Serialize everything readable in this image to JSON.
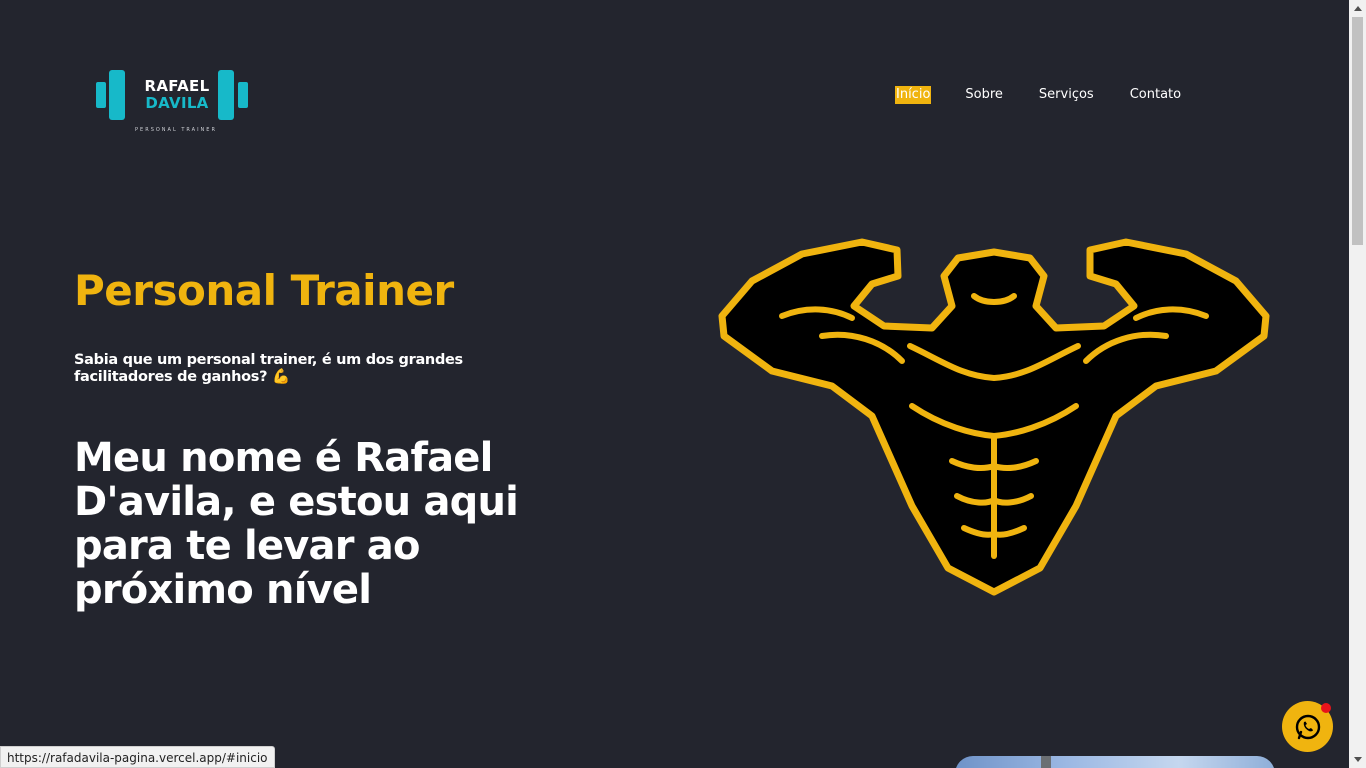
{
  "logo": {
    "line1": "RAFAEL",
    "line2": "DAVILA",
    "subtitle": "PERSONAL TRAINER",
    "accent_color": "#17b9c9"
  },
  "nav": {
    "items": [
      {
        "label": "Início",
        "active": true
      },
      {
        "label": "Sobre",
        "active": false
      },
      {
        "label": "Serviços",
        "active": false
      },
      {
        "label": "Contato",
        "active": false
      }
    ]
  },
  "hero": {
    "title": "Personal Trainer",
    "subtitle": "Sabia que um personal trainer, é um dos grandes facilitadores de ganhos? 💪",
    "headline": "Meu nome é Rafael D'avila, e estou aqui para te levar ao próximo nível"
  },
  "colors": {
    "background": "#23252e",
    "accent": "#f0b40f",
    "text": "#ffffff"
  },
  "icons": {
    "mascot": "bodybuilder-mascot-icon",
    "whatsapp": "whatsapp-icon"
  },
  "status_bar": {
    "url": "https://rafadavila-pagina.vercel.app/#inicio"
  }
}
